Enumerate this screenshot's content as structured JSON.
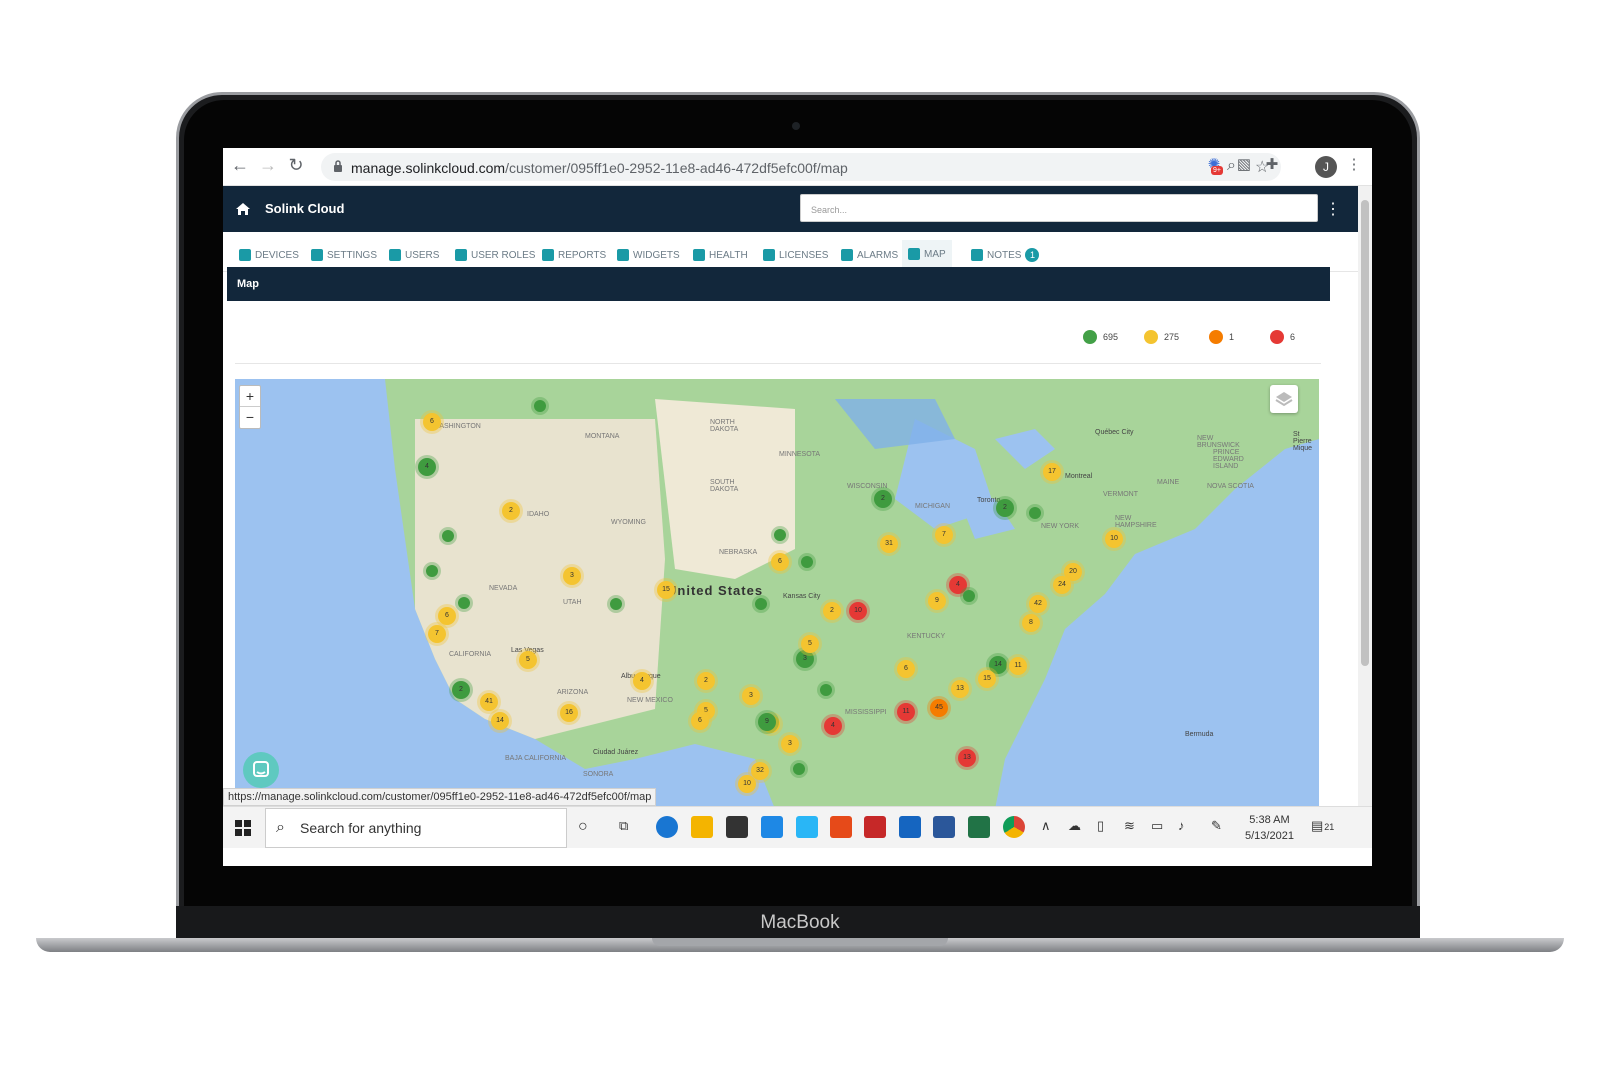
{
  "device": {
    "brand_label": "MacBook"
  },
  "browser": {
    "url_host": "manage.solinkcloud.com",
    "url_path": "/customer/095ff1e0-2952-11e8-ad46-472df5efc00f/map",
    "profile_initial": "J",
    "ext_badge": "9+"
  },
  "app": {
    "title": "Solink Cloud",
    "search_placeholder": "Search..."
  },
  "tabs": [
    {
      "label": "DEVICES"
    },
    {
      "label": "SETTINGS"
    },
    {
      "label": "USERS"
    },
    {
      "label": "USER ROLES"
    },
    {
      "label": "REPORTS"
    },
    {
      "label": "WIDGETS"
    },
    {
      "label": "HEALTH"
    },
    {
      "label": "LICENSES"
    },
    {
      "label": "ALARMS"
    },
    {
      "label": "MAP"
    },
    {
      "label": "NOTES",
      "badge": "1"
    }
  ],
  "map_panel": {
    "title": "Map",
    "legend": [
      {
        "count": "695",
        "color": "#43a047"
      },
      {
        "count": "275",
        "color": "#f4c430"
      },
      {
        "count": "1",
        "color": "#f57c00"
      },
      {
        "count": "6",
        "color": "#e53935"
      }
    ],
    "zoom_in": "+",
    "zoom_out": "−",
    "labels": {
      "country": "United States",
      "states": [
        "WASHINGTON",
        "MONTANA",
        "NORTH DAKOTA",
        "SOUTH DAKOTA",
        "MINNESOTA",
        "WISCONSIN",
        "MICHIGAN",
        "IDAHO",
        "WYOMING",
        "NEBRASKA",
        "NEVADA",
        "UTAH",
        "CALIFORNIA",
        "ARIZONA",
        "NEW MEXICO",
        "KENTUCKY",
        "MISSISSIPPI",
        "VERMONT",
        "MAINE",
        "NEW YORK",
        "NEW HAMPSHIRE",
        "NEW BRUNSWICK",
        "PRINCE EDWARD ISLAND",
        "NOVA SCOTIA",
        "SONORA",
        "BAJA CALIFORNIA"
      ],
      "cities": [
        "Québec City",
        "Montreal",
        "Toronto",
        "Kansas City",
        "Las Vegas",
        "Albuquerque",
        "Ciudad Juárez",
        "Bermuda",
        "St Pierre Mique"
      ]
    },
    "clusters": [
      {
        "label": "6",
        "status": "yellow"
      },
      {
        "label": "4",
        "status": "green"
      },
      {
        "label": "2",
        "status": "yellow"
      },
      {
        "label": "3",
        "status": "yellow"
      },
      {
        "label": "6",
        "status": "yellow"
      },
      {
        "label": "7",
        "status": "yellow"
      },
      {
        "label": "5",
        "status": "yellow"
      },
      {
        "label": "2",
        "status": "green"
      },
      {
        "label": "41",
        "status": "yellow"
      },
      {
        "label": "14",
        "status": "yellow"
      },
      {
        "label": "16",
        "status": "yellow"
      },
      {
        "label": "15",
        "status": "yellow"
      },
      {
        "label": "4",
        "status": "yellow"
      },
      {
        "label": "2",
        "status": "yellow"
      },
      {
        "label": "5",
        "status": "yellow"
      },
      {
        "label": "6",
        "status": "yellow"
      },
      {
        "label": "3",
        "status": "yellow"
      },
      {
        "label": "6",
        "status": "yellow"
      },
      {
        "label": "2",
        "status": "yellow"
      },
      {
        "label": "10",
        "status": "red"
      },
      {
        "label": "4",
        "status": "red"
      },
      {
        "label": "4",
        "status": "red"
      },
      {
        "label": "11",
        "status": "red"
      },
      {
        "label": "13",
        "status": "red"
      },
      {
        "label": "45",
        "status": "orange"
      },
      {
        "label": "31",
        "status": "yellow"
      },
      {
        "label": "7",
        "status": "yellow"
      },
      {
        "label": "2",
        "status": "green"
      },
      {
        "label": "17",
        "status": "yellow"
      },
      {
        "label": "2",
        "status": "green"
      },
      {
        "label": "10",
        "status": "yellow"
      },
      {
        "label": "20",
        "status": "yellow"
      },
      {
        "label": "24",
        "status": "yellow"
      },
      {
        "label": "42",
        "status": "yellow"
      },
      {
        "label": "8",
        "status": "yellow"
      },
      {
        "label": "61",
        "status": "yellow"
      },
      {
        "label": "32",
        "status": "yellow"
      },
      {
        "label": "10",
        "status": "yellow"
      },
      {
        "label": "14",
        "status": "green"
      },
      {
        "label": "11",
        "status": "yellow"
      },
      {
        "label": "13",
        "status": "yellow"
      },
      {
        "label": "15",
        "status": "yellow"
      },
      {
        "label": "9",
        "status": "yellow"
      },
      {
        "label": "9",
        "status": "green"
      },
      {
        "label": "3",
        "status": "yellow"
      },
      {
        "label": "3",
        "status": "green"
      },
      {
        "label": "5",
        "status": "yellow"
      },
      {
        "label": "6",
        "status": "yellow"
      },
      {
        "label": "",
        "status": "green"
      },
      {
        "label": "",
        "status": "green"
      },
      {
        "label": "",
        "status": "green"
      },
      {
        "label": "",
        "status": "green"
      },
      {
        "label": "",
        "status": "green"
      },
      {
        "label": "",
        "status": "green"
      },
      {
        "label": "",
        "status": "green"
      },
      {
        "label": "",
        "status": "green"
      },
      {
        "label": "",
        "status": "green"
      },
      {
        "label": "",
        "status": "green"
      },
      {
        "label": "",
        "status": "green"
      },
      {
        "label": "",
        "status": "green"
      }
    ]
  },
  "status_url": "https://manage.solinkcloud.com/customer/095ff1e0-2952-11e8-ad46-472df5efc00f/map",
  "taskbar": {
    "search_placeholder": "Search for anything",
    "time": "5:38 AM",
    "date": "5/13/2021",
    "notification_count": "21"
  },
  "colors": {
    "navy": "#12273b",
    "teal": "#1a9aa6",
    "green": "#43a047",
    "yellow": "#f4c430",
    "orange": "#f57c00",
    "red": "#e53935"
  }
}
